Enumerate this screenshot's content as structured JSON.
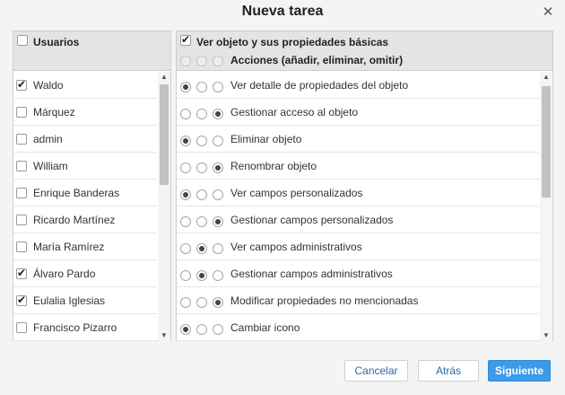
{
  "dialog": {
    "title": "Nueva tarea"
  },
  "users": {
    "header_label": "Usuarios",
    "header_checked": false,
    "items": [
      {
        "name": "Waldo",
        "checked": true
      },
      {
        "name": "Márquez",
        "checked": false
      },
      {
        "name": "admin",
        "checked": false
      },
      {
        "name": "William",
        "checked": false
      },
      {
        "name": "Enrique Banderas",
        "checked": false
      },
      {
        "name": "Ricardo Martínez",
        "checked": false
      },
      {
        "name": "María Ramírez",
        "checked": false
      },
      {
        "name": "Álvaro Pardo",
        "checked": true
      },
      {
        "name": "Eulalia Iglesias",
        "checked": true
      },
      {
        "name": "Francisco Pizarro",
        "checked": false
      }
    ]
  },
  "permissions": {
    "header_label": "Ver objeto y sus propiedades básicas",
    "header_checked": true,
    "actions_label": "Acciones (añadir, eliminar, omitir)",
    "items": [
      {
        "label": "Ver detalle de propiedades del objeto",
        "selected": 0
      },
      {
        "label": "Gestionar acceso al objeto",
        "selected": 2
      },
      {
        "label": "Eliminar objeto",
        "selected": 0
      },
      {
        "label": "Renombrar objeto",
        "selected": 2
      },
      {
        "label": "Ver campos personalizados",
        "selected": 0
      },
      {
        "label": "Gestionar campos personalizados",
        "selected": 2
      },
      {
        "label": "Ver campos administrativos",
        "selected": 1
      },
      {
        "label": "Gestionar campos administrativos",
        "selected": 1
      },
      {
        "label": "Modificar propiedades no mencionadas",
        "selected": 2
      },
      {
        "label": "Cambiar icono",
        "selected": 0
      }
    ]
  },
  "buttons": {
    "cancel": "Cancelar",
    "back": "Atrás",
    "next": "Siguiente"
  },
  "icons": {
    "close": "close-icon",
    "scroll_up": "scroll-up-arrow-icon",
    "scroll_down": "scroll-down-arrow-icon"
  },
  "colors": {
    "primary_button": "#3c9be8",
    "link_text": "#2a6aa8",
    "header_bg": "#e4e4e4"
  }
}
